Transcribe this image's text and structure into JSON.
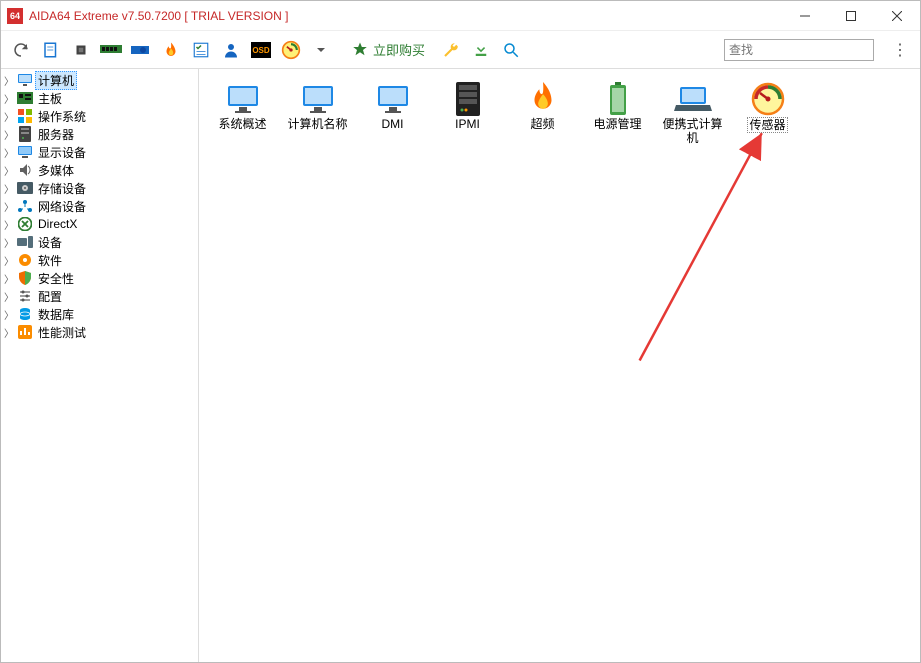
{
  "window": {
    "title": "AIDA64 Extreme v7.50.7200  [ TRIAL VERSION ]",
    "icon_text": "64"
  },
  "toolbar": {
    "buy_label": "立即购买",
    "search_placeholder": "查找"
  },
  "sidebar": {
    "items": [
      {
        "label": "计算机",
        "icon": "monitor",
        "color": "#1e88e5",
        "selected": true
      },
      {
        "label": "主板",
        "icon": "board",
        "color": "#2e7d32"
      },
      {
        "label": "操作系统",
        "icon": "windows",
        "color": "#1976d2"
      },
      {
        "label": "服务器",
        "icon": "server",
        "color": "#424242"
      },
      {
        "label": "显示设备",
        "icon": "display",
        "color": "#1e88e5"
      },
      {
        "label": "多媒体",
        "icon": "speaker",
        "color": "#616161"
      },
      {
        "label": "存储设备",
        "icon": "drive",
        "color": "#455a64"
      },
      {
        "label": "网络设备",
        "icon": "network",
        "color": "#0277bd"
      },
      {
        "label": "DirectX",
        "icon": "directx",
        "color": "#2e7d32"
      },
      {
        "label": "设备",
        "icon": "devices",
        "color": "#546e7a"
      },
      {
        "label": "软件",
        "icon": "disc",
        "color": "#fb8c00"
      },
      {
        "label": "安全性",
        "icon": "shield",
        "color": "#ef6c00"
      },
      {
        "label": "配置",
        "icon": "config",
        "color": "#9e9e9e"
      },
      {
        "label": "数据库",
        "icon": "database",
        "color": "#039be5"
      },
      {
        "label": "性能测试",
        "icon": "benchmark",
        "color": "#fb8c00"
      }
    ]
  },
  "main": {
    "items": [
      {
        "label": "系统概述",
        "icon": "monitor"
      },
      {
        "label": "计算机名称",
        "icon": "monitor"
      },
      {
        "label": "DMI",
        "icon": "monitor"
      },
      {
        "label": "IPMI",
        "icon": "server"
      },
      {
        "label": "超频",
        "icon": "flame"
      },
      {
        "label": "电源管理",
        "icon": "battery"
      },
      {
        "label": "便携式计算机",
        "icon": "laptop"
      },
      {
        "label": "传感器",
        "icon": "gauge",
        "selected": true
      }
    ]
  }
}
